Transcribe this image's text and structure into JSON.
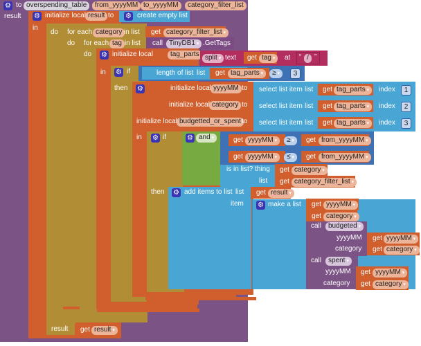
{
  "procedure": {
    "to_label": "to",
    "name": "overspending_table",
    "params": [
      "from_yyyyMM",
      "to_yyyyMM",
      "category_filter_list"
    ],
    "result_label": "result"
  },
  "init_result": {
    "label": "initialize local",
    "var": "result",
    "to": "to",
    "value_label": "create empty list",
    "in_label": "in"
  },
  "for_category": {
    "do_label": "do",
    "label": "for each",
    "var": "category",
    "in_list": "in list",
    "get": "get",
    "source": "category_filter_list"
  },
  "for_tag": {
    "do_label": "do",
    "label": "for each",
    "var": "tag",
    "in_list": "in list",
    "call": "call",
    "component": "TinyDB1",
    "method": ".GetTags"
  },
  "init_tag_parts": {
    "do_label": "do",
    "label": "initialize local",
    "var": "tag_parts",
    "to": "to",
    "split": "split",
    "text_label": "text",
    "get": "get",
    "source": "tag",
    "at_label": "at",
    "separator": "/",
    "in_label": "in"
  },
  "if_length": {
    "if_label": "if",
    "length_label": "length of list",
    "list_label": "list",
    "get": "get",
    "source": "tag_parts",
    "op": "≥",
    "value": "3",
    "then_label": "then"
  },
  "init_multi": {
    "label": "initialize local",
    "to": "to",
    "select_label": "select list item",
    "list_label": "list",
    "get": "get",
    "index_label": "index",
    "rows": [
      {
        "var": "yyyyMM",
        "source": "tag_parts",
        "index": "1"
      },
      {
        "var": "category",
        "source": "tag_parts",
        "index": "2"
      },
      {
        "var": "budgetted_or_spent",
        "source": "tag_parts",
        "index": "3"
      }
    ],
    "in_label": "in"
  },
  "if_and": {
    "if_label": "if",
    "and_label": "and",
    "get": "get",
    "compare1": {
      "left": "yyyyMM",
      "op": "≥",
      "right": "from_yyyyMM"
    },
    "compare2": {
      "left": "yyyyMM",
      "op": "≤",
      "right": "from_yyyyMM"
    },
    "is_in_list": {
      "label": "is in list? thing",
      "thing": "category",
      "list_label": "list",
      "list": "category_filter_list"
    },
    "then_label": "then"
  },
  "add_items": {
    "label": "add items to list",
    "list_label": "list",
    "get": "get",
    "list": "result",
    "item_label": "item",
    "make_list": "make a list",
    "items": [
      "yyyyMM",
      "category"
    ],
    "calls": [
      {
        "call": "call",
        "name": "budgeted",
        "args": [
          {
            "label": "yyyyMM",
            "get": "yyyyMM"
          },
          {
            "label": "category",
            "get": "category"
          }
        ]
      },
      {
        "call": "call",
        "name": "spent",
        "args": [
          {
            "label": "yyyyMM",
            "get": "yyyyMM"
          },
          {
            "label": "category",
            "get": "category"
          }
        ]
      }
    ]
  },
  "return": {
    "label": "result",
    "get": "get",
    "var": "result"
  },
  "colors": {
    "procedure": "#7c5385",
    "variables": "#d05f2d",
    "control": "#b18e35",
    "lists": "#49a6d4",
    "logic": "#77ab41",
    "math": "#3f71b5",
    "text": "#b32d5e",
    "component": "#7d4b83"
  }
}
